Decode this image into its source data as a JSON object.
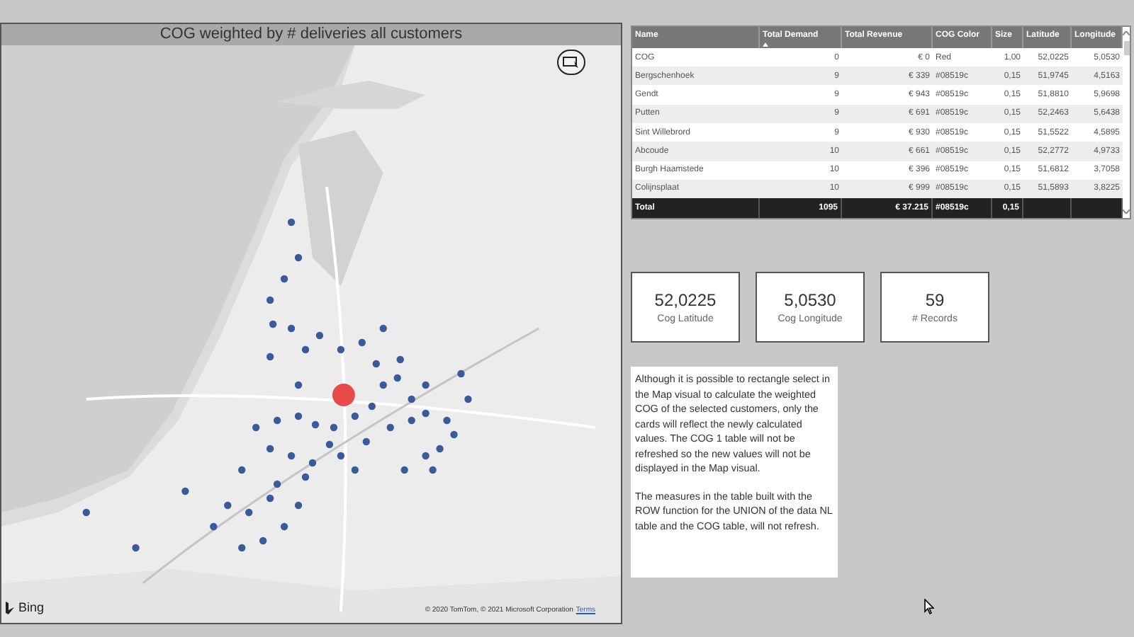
{
  "map": {
    "title": "COG weighted by # deliveries all customers",
    "logo": "Bing",
    "attribution": "© 2020 TomTom, © 2021 Microsoft Corporation",
    "terms_link": "Terms"
  },
  "table": {
    "columns": [
      {
        "label": "Name",
        "sorted": false
      },
      {
        "label": "Total Demand",
        "sorted": true
      },
      {
        "label": "Total Revenue",
        "sorted": false
      },
      {
        "label": "COG Color",
        "sorted": false
      },
      {
        "label": "Size",
        "sorted": false
      },
      {
        "label": "Latitude",
        "sorted": false
      },
      {
        "label": "Longitude",
        "sorted": false
      }
    ],
    "rows": [
      [
        "COG",
        "0",
        "€ 0",
        "Red",
        "1,00",
        "52,0225",
        "5,0530"
      ],
      [
        "Bergschenhoek",
        "9",
        "€ 339",
        "#08519c",
        "0,15",
        "51,9745",
        "4,5163"
      ],
      [
        "Gendt",
        "9",
        "€ 943",
        "#08519c",
        "0,15",
        "51,8810",
        "5,9698"
      ],
      [
        "Putten",
        "9",
        "€ 691",
        "#08519c",
        "0,15",
        "52,2463",
        "5,6438"
      ],
      [
        "Sint Willebrord",
        "9",
        "€ 930",
        "#08519c",
        "0,15",
        "51,5522",
        "4,5895"
      ],
      [
        "Abcoude",
        "10",
        "€ 661",
        "#08519c",
        "0,15",
        "52,2772",
        "4,9733"
      ],
      [
        "Burgh Haamstede",
        "10",
        "€ 396",
        "#08519c",
        "0,15",
        "51,6812",
        "3,7058"
      ],
      [
        "Colijnsplaat",
        "10",
        "€ 999",
        "#08519c",
        "0,15",
        "51,5893",
        "3,8225"
      ]
    ],
    "total": [
      "Total",
      "1095",
      "€ 37.215",
      "#08519c",
      "0,15"
    ]
  },
  "cards": [
    {
      "value": "52,0225",
      "label": "Cog Latitude"
    },
    {
      "value": "5,0530",
      "label": "Cog Longitude"
    },
    {
      "value": "59",
      "label": "# Records"
    }
  ],
  "note": [
    "Although it is possible to rectangle select in the Map visual to calculate the weighted COG of the selected customers, only the cards will reflect the newly calculated values.  The COG 1 table will not be refreshed so the new values will not be displayed in the Map visual.",
    "The measures in the table built with the ROW function for the UNION of the data NL table and the COG table, will not refresh."
  ]
}
